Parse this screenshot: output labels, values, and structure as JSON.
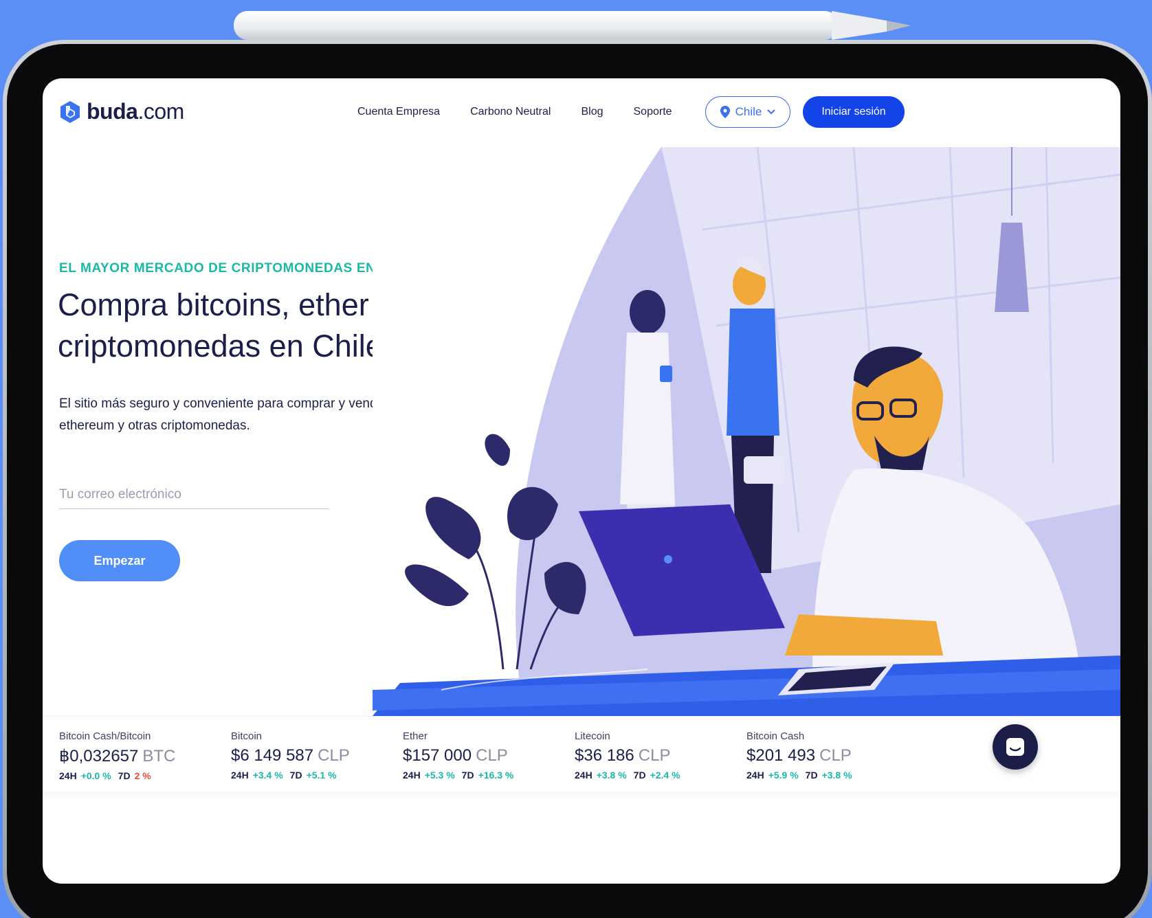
{
  "brand": {
    "logo_bold": "buda",
    "logo_rest": ".com"
  },
  "nav": {
    "items": [
      {
        "label": "Cuenta Empresa"
      },
      {
        "label": "Carbono Neutral"
      },
      {
        "label": "Blog"
      },
      {
        "label": "Soporte"
      }
    ],
    "country": "Chile",
    "login": "Iniciar sesión"
  },
  "hero": {
    "eyebrow": "EL MAYOR MERCADO DE CRIPTOMONEDAS EN SUDAMÉRICA",
    "headline": "Compra bitcoins, ether y más criptomonedas en Chile",
    "subtitle": "El sitio más seguro y conveniente para comprar y vender bitcoins, ethereum y otras criptomonedas.",
    "email_placeholder": "Tu correo electrónico",
    "email_value": "",
    "cta": "Empezar"
  },
  "ticker": [
    {
      "name": "Bitcoin Cash/Bitcoin",
      "price": "฿0,032657",
      "currency": "BTC",
      "h24_label": "24H",
      "h24": "+0.0 %",
      "d7_label": "7D",
      "d7": "2 %",
      "d7_negative": true
    },
    {
      "name": "Bitcoin",
      "price": "$6 149 587",
      "currency": "CLP",
      "h24_label": "24H",
      "h24": "+3.4 %",
      "d7_label": "7D",
      "d7": "+5.1 %",
      "d7_negative": false
    },
    {
      "name": "Ether",
      "price": "$157 000",
      "currency": "CLP",
      "h24_label": "24H",
      "h24": "+5.3 %",
      "d7_label": "7D",
      "d7": "+16.3 %",
      "d7_negative": false
    },
    {
      "name": "Litecoin",
      "price": "$36 186",
      "currency": "CLP",
      "h24_label": "24H",
      "h24": "+3.8 %",
      "d7_label": "7D",
      "d7": "+2.4 %",
      "d7_negative": false
    },
    {
      "name": "Bitcoin Cash",
      "price": "$201 493",
      "currency": "CLP",
      "h24_label": "24H",
      "h24": "+5.9 %",
      "d7_label": "7D",
      "d7": "+3.8 %",
      "d7_negative": false
    }
  ],
  "colors": {
    "background": "#5b8ff5",
    "accent_teal": "#1ab9a6",
    "primary_blue": "#1344e8",
    "cta_blue": "#4f8ff7",
    "navy": "#1c1e4a",
    "negative_red": "#e84b3c"
  },
  "icons": {
    "logo": "buda-logo-icon",
    "location": "location-pin-icon",
    "chevron": "chevron-down-icon",
    "chat": "chat-icon"
  }
}
